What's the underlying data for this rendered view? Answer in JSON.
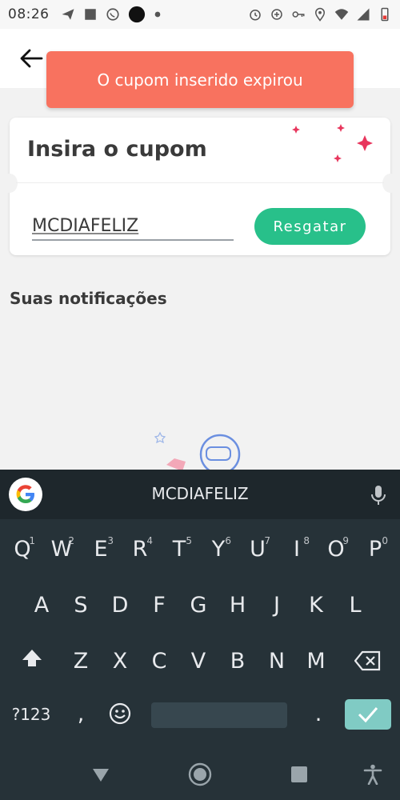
{
  "status_bar": {
    "time": "08:26",
    "left_icons": [
      "send-icon",
      "stop-square-icon",
      "whatsapp-icon",
      "dot-icon",
      "small-dot-icon"
    ],
    "right_icons": [
      "alarm-icon",
      "data-saver-icon",
      "key-icon",
      "location-icon",
      "wifi-icon",
      "signal-icon",
      "battery-icon"
    ]
  },
  "header": {
    "back_icon": "arrow-left-icon"
  },
  "toast": {
    "message": "O cupom inserido expirou",
    "color": "#f8725f"
  },
  "coupon": {
    "title": "Insira o cupom",
    "input_value": "MCDIAFELIZ",
    "redeem_label": "Resgatar",
    "accent_color": "#28c08a",
    "sparkle_color": "#e8365d"
  },
  "notifications": {
    "heading": "Suas notificações"
  },
  "keyboard": {
    "suggestion": "MCDIAFELIZ",
    "row1": [
      {
        "label": "Q",
        "hint": "1"
      },
      {
        "label": "W",
        "hint": "2"
      },
      {
        "label": "E",
        "hint": "3"
      },
      {
        "label": "R",
        "hint": "4"
      },
      {
        "label": "T",
        "hint": "5"
      },
      {
        "label": "Y",
        "hint": "6"
      },
      {
        "label": "U",
        "hint": "7"
      },
      {
        "label": "I",
        "hint": "8"
      },
      {
        "label": "O",
        "hint": "9"
      },
      {
        "label": "P",
        "hint": "0"
      }
    ],
    "row2": [
      "A",
      "S",
      "D",
      "F",
      "G",
      "H",
      "J",
      "K",
      "L"
    ],
    "row3": [
      "Z",
      "X",
      "C",
      "V",
      "B",
      "N",
      "M"
    ],
    "symbols_label": "?123",
    "comma_label": ",",
    "period_label": ".",
    "emoji_icon": "emoji-icon",
    "shift_icon": "shift-icon",
    "backspace_icon": "backspace-icon",
    "enter_icon": "checkmark-icon"
  },
  "nav_bar": {
    "icons": [
      "back-triangle-icon",
      "home-circle-icon",
      "recents-square-icon",
      "accessibility-icon"
    ]
  }
}
